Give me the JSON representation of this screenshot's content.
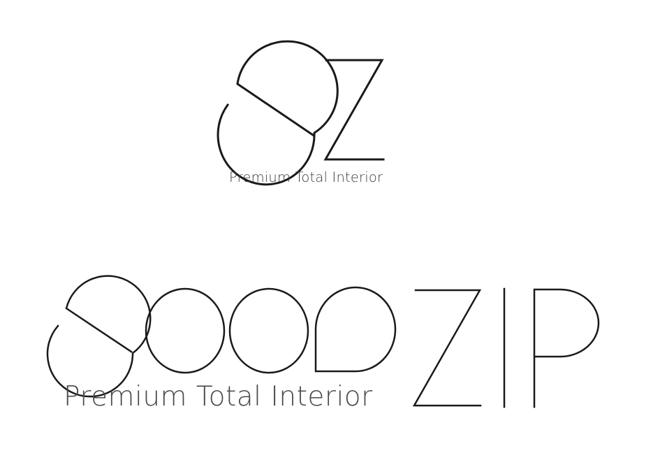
{
  "logos": {
    "small": {
      "wordmark": "oZ",
      "tagline": "Premium Total Interior"
    },
    "large": {
      "wordmark": "oooo ZIP",
      "tagline": "Premium Total Interior"
    }
  },
  "colors": {
    "background": "#ffffff",
    "stroke": "#1a1a1a",
    "tagline_small": "#3a3a3a",
    "tagline_large": "#4a4a4a"
  }
}
